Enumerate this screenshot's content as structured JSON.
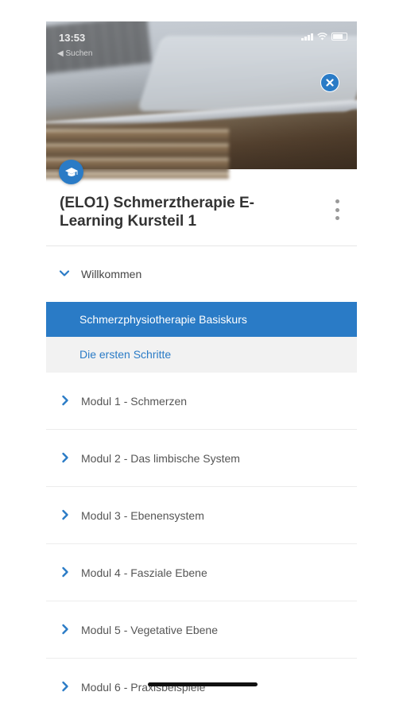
{
  "status_bar": {
    "time": "13:53",
    "back_label": "◀ Suchen"
  },
  "course": {
    "title": "(ELO1) Schmerztherapie E-Learning Kursteil 1"
  },
  "section": {
    "label": "Willkommen",
    "expanded": true,
    "lessons": [
      {
        "label": "Schmerzphysiotherapie Basiskurs",
        "active": true
      },
      {
        "label": "Die ersten Schritte",
        "active": false
      }
    ]
  },
  "modules": [
    {
      "label": "Modul 1 - Schmerzen"
    },
    {
      "label": "Modul 2 - Das limbische System"
    },
    {
      "label": "Modul 3 - Ebenensystem"
    },
    {
      "label": "Modul 4 - Fasziale Ebene"
    },
    {
      "label": "Modul 5 - Vegetative Ebene"
    },
    {
      "label": "Modul 6 - Praxisbeispiele"
    }
  ],
  "icons": {
    "close": "close-icon",
    "course": "graduation-cap-icon",
    "more": "more-vertical-icon",
    "expanded": "chevron-down-icon",
    "collapsed": "chevron-right-icon"
  },
  "colors": {
    "accent": "#2a7bc6",
    "title_text": "#333333",
    "inactive_lesson_bg": "#f2f2f2"
  }
}
